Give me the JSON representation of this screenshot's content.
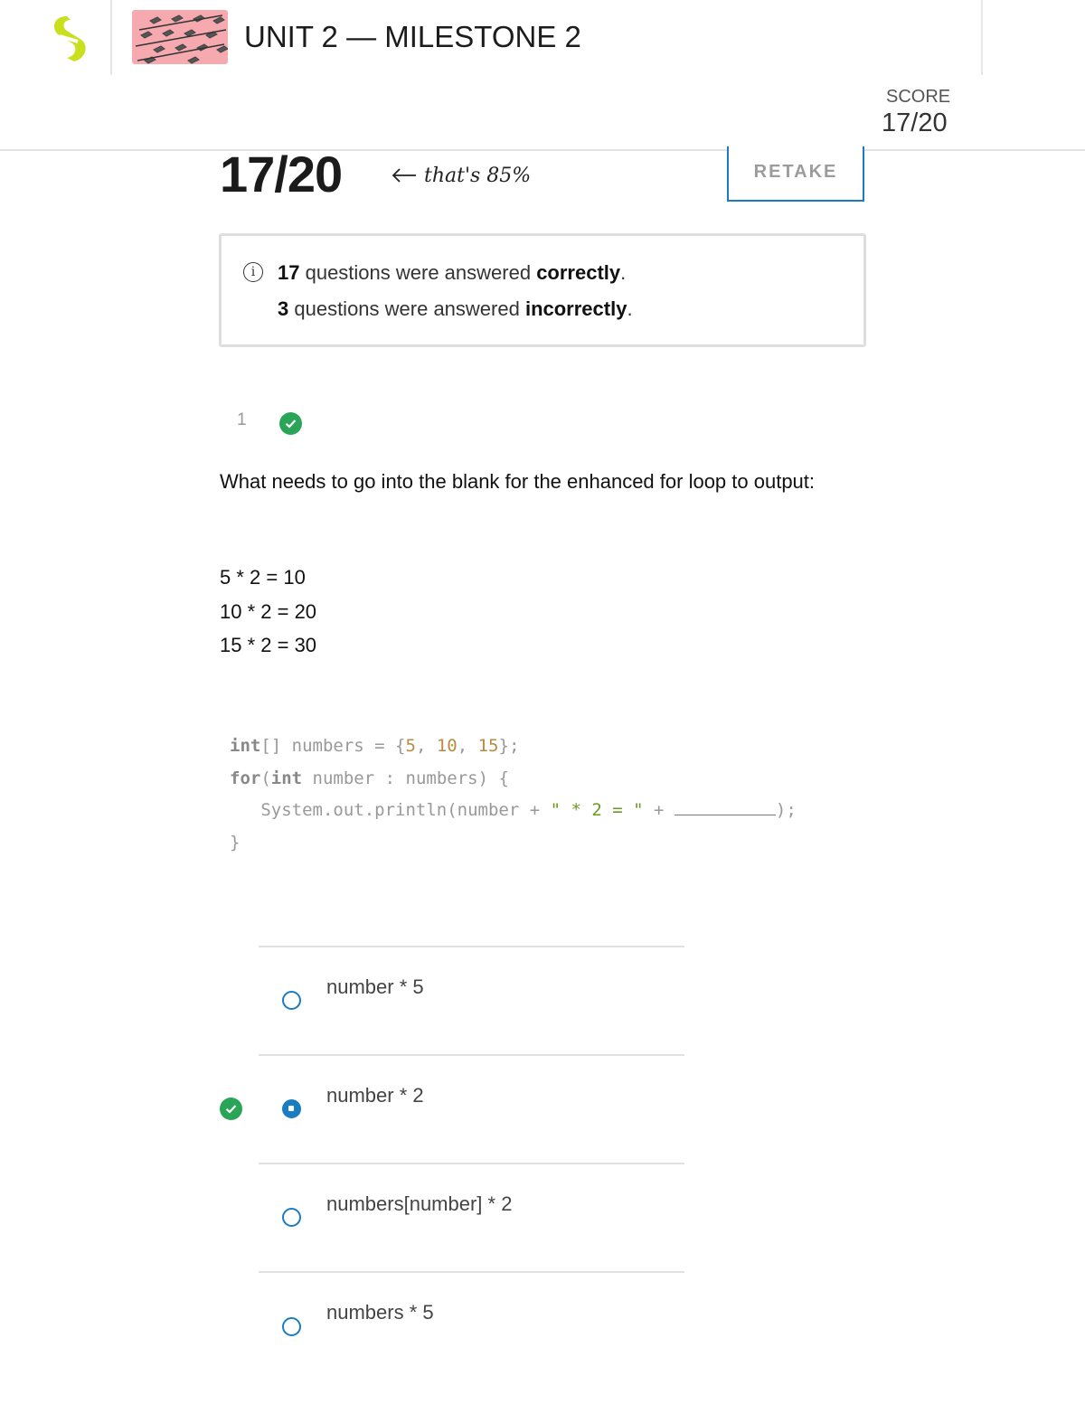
{
  "header": {
    "title": "UNIT 2 — MILESTONE 2",
    "score_label": "SCORE",
    "score_value": "17/20"
  },
  "results": {
    "big_score": "17/20",
    "percent_note": "that's 85%",
    "retake_label": "RETAKE",
    "summary": {
      "correct_count": "17",
      "correct_text": " questions were answered ",
      "correct_word": "correctly",
      "incorrect_count": "3",
      "incorrect_text": " questions were answered ",
      "incorrect_word": "incorrectly",
      "period": "."
    }
  },
  "question": {
    "number": "1",
    "status": "correct",
    "prompt": "What needs to go into the blank for the enhanced for loop to output:",
    "outputs": [
      "5 * 2 = 10",
      "10 * 2 = 20",
      "15 * 2 = 30"
    ],
    "code": {
      "line1": {
        "kw": "int",
        "rest1": "[] numbers = {",
        "n1": "5",
        "sep1": ", ",
        "n2": "10",
        "sep2": ", ",
        "n3": "15",
        "end": "};"
      },
      "line2": {
        "kw1": "for",
        "p1": "(",
        "kw2": "int",
        "rest": " number : numbers) {"
      },
      "line3": {
        "pre": "   System.out.println(number + ",
        "str": "\" * 2 = \"",
        "mid": " + ",
        "end": ");"
      },
      "line4": "}"
    },
    "options": [
      {
        "label": "number * 5",
        "selected": false
      },
      {
        "label": "number * 2",
        "selected": true,
        "correct": true
      },
      {
        "label": "numbers[number] * 2",
        "selected": false
      },
      {
        "label": "numbers * 5",
        "selected": false
      }
    ]
  },
  "colors": {
    "accent": "#1a7cc1",
    "correct_green": "#2aa557",
    "logo_lime": "#c8e01e"
  }
}
